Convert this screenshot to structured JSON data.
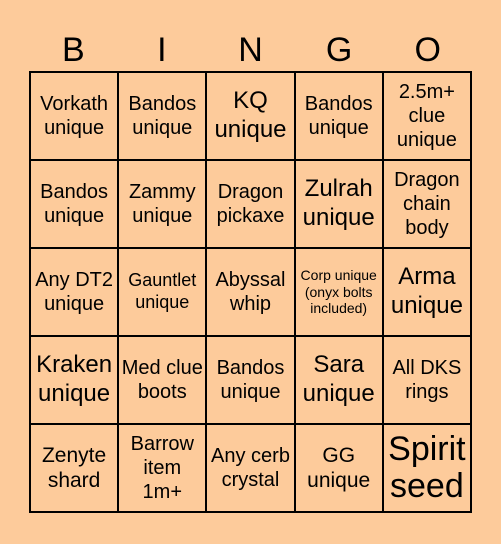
{
  "header": {
    "letters": [
      "B",
      "I",
      "N",
      "G",
      "O"
    ]
  },
  "cells": [
    [
      "Vorkath unique",
      "Bandos unique",
      "KQ unique",
      "Bandos unique",
      "2.5m+ clue unique"
    ],
    [
      "Bandos unique",
      "Zammy unique",
      "Dragon pickaxe",
      "Zulrah unique",
      "Dragon chain body"
    ],
    [
      "Any DT2 unique",
      "Gauntlet unique",
      "Abyssal whip",
      "Corp unique (onyx bolts included)",
      "Arma unique"
    ],
    [
      "Kraken unique",
      "Med clue boots",
      "Bandos unique",
      "Sara unique",
      "All DKS rings"
    ],
    [
      "Zenyte shard",
      "Barrow item 1m+",
      "Any cerb crystal",
      "GG unique",
      "Spirit seed"
    ]
  ],
  "colors": {
    "background": "#fdcb9b",
    "border": "#000000"
  }
}
